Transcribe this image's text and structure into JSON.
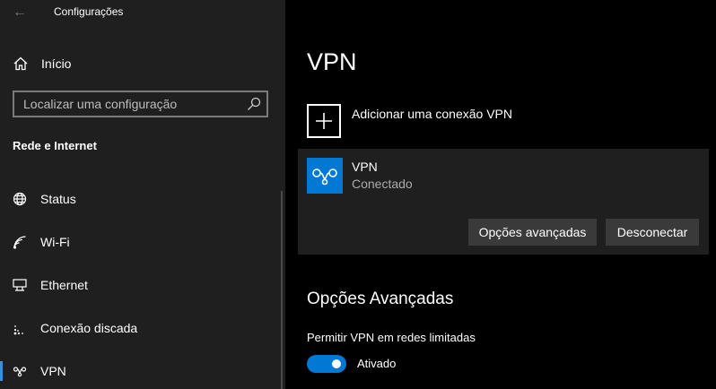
{
  "window": {
    "title": "Configurações"
  },
  "sidebar": {
    "home_label": "Início",
    "search": {
      "placeholder": "Localizar uma configuração"
    },
    "section_title": "Rede e Internet",
    "items": [
      {
        "label": "Status",
        "icon": "globe-icon"
      },
      {
        "label": "Wi-Fi",
        "icon": "wifi-icon"
      },
      {
        "label": "Ethernet",
        "icon": "ethernet-icon"
      },
      {
        "label": "Conexão discada",
        "icon": "dialup-icon"
      },
      {
        "label": "VPN",
        "icon": "vpn-icon",
        "active": true
      }
    ]
  },
  "main": {
    "title": "VPN",
    "add_vpn_label": "Adicionar uma conexão VPN",
    "connection": {
      "name": "VPN",
      "status": "Conectado",
      "advanced_button": "Opções avançadas",
      "disconnect_button": "Desconectar"
    },
    "advanced_section": {
      "title": "Opções Avançadas",
      "metered_label": "Permitir VPN em redes limitadas",
      "metered_toggle": {
        "state": "Ativado",
        "on": true
      }
    }
  },
  "colors": {
    "accent": "#0078d4",
    "sidebar_bg": "#1f1f1f",
    "main_bg": "#000000",
    "button_bg": "#3a3a3a"
  }
}
